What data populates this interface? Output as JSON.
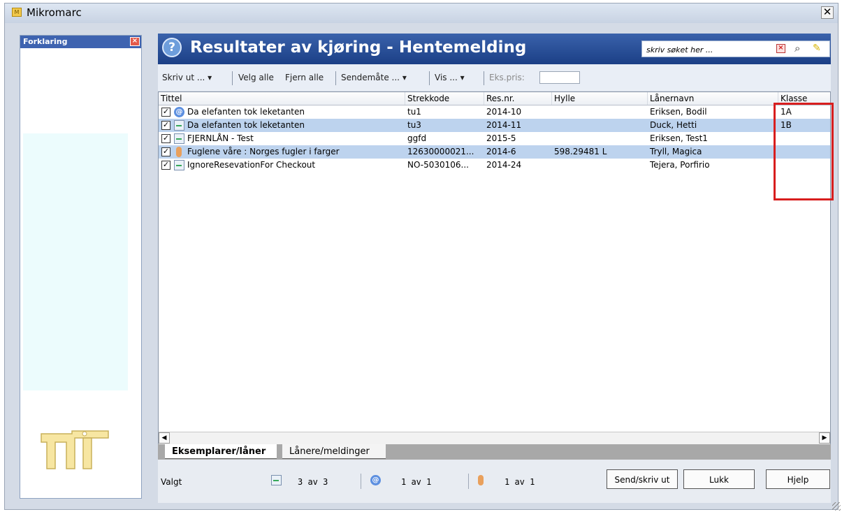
{
  "window": {
    "title": "Mikromarc",
    "close_label": "✕"
  },
  "sidebar": {
    "title": "Forklaring",
    "close_label": "×"
  },
  "header": {
    "help_label": "?",
    "title": "Resultater av kjøring - Hentemelding",
    "search_placeholder": "skriv søket her ...",
    "search_clear_label": "×"
  },
  "toolbar": {
    "print": "Skriv ut ...",
    "select_all": "Velg alle",
    "remove_all": "Fjern alle",
    "send_method": "Sendemåte ...",
    "view": "Vis ...",
    "price_label": "Eks.pris:",
    "dropdown_arrow": "▾"
  },
  "table": {
    "columns": [
      "Tittel",
      "Strekkode",
      "Res.nr.",
      "Hylle",
      "Lånernavn",
      "Klasse"
    ],
    "rows": [
      {
        "checked": "✓",
        "type": "email",
        "title": "Da elefanten tok leketanten",
        "barcode": "tu1",
        "res": "2014-10",
        "shelf": "",
        "borrower": "Eriksen, Bodil",
        "class": "1A"
      },
      {
        "checked": "✓",
        "type": "print",
        "title": "Da elefanten tok leketanten",
        "barcode": "tu3",
        "res": "2014-11",
        "shelf": "",
        "borrower": "Duck, Hetti",
        "class": "1B"
      },
      {
        "checked": "✓",
        "type": "print",
        "title": "FJERNLÅN - Test",
        "barcode": "ggfd",
        "res": "2015-5",
        "shelf": "",
        "borrower": "Eriksen, Test1",
        "class": ""
      },
      {
        "checked": "✓",
        "type": "sms",
        "title": "Fuglene våre : Norges fugler i farger",
        "barcode": "12630000021...",
        "res": "2014-6",
        "shelf": "598.29481 L",
        "borrower": "Tryll, Magica",
        "class": ""
      },
      {
        "checked": "✓",
        "type": "print",
        "title": "IgnoreResevationFor Checkout",
        "barcode": "NO-5030106...",
        "res": "2014-24",
        "shelf": "",
        "borrower": "Tejera, Porfirio",
        "class": ""
      }
    ]
  },
  "tabs": [
    "Eksemplarer/låner",
    "Lånere/meldinger"
  ],
  "status": {
    "label": "Valgt",
    "print_count": "3 av 3",
    "email_count": "1 av 1",
    "sms_count": "1 av 1"
  },
  "buttons": {
    "send": "Send/skriv ut",
    "close": "Lukk",
    "help": "Hjelp"
  },
  "scroll": {
    "left": "◀",
    "right": "▶"
  },
  "colors": {
    "header": "#2b4f98",
    "selected_row": "#bdd3ee",
    "highlight": "#d81e1e"
  }
}
